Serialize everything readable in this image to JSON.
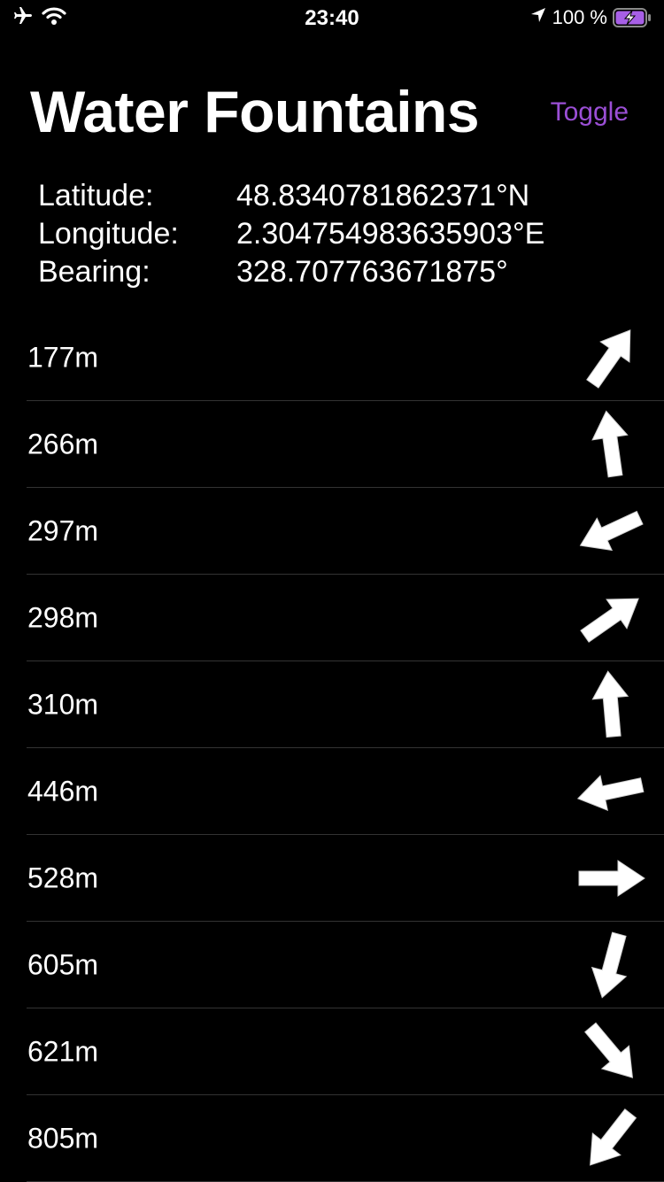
{
  "status_bar": {
    "time": "23:40",
    "battery_text": "100 %"
  },
  "header": {
    "title": "Water Fountains",
    "toggle_label": "Toggle"
  },
  "colors": {
    "accent": "#9b4fd6",
    "battery": "#a75fe6"
  },
  "info": [
    {
      "label": "Latitude:",
      "value": "48.8340781862371°N"
    },
    {
      "label": "Longitude:",
      "value": "2.304754983635903°E"
    },
    {
      "label": "Bearing:",
      "value": "328.707763671875°"
    }
  ],
  "fountains": [
    {
      "distance": "177m",
      "arrow_icon": "arrow-up-right-icon",
      "arrow_angle": 35
    },
    {
      "distance": "266m",
      "arrow_icon": "arrow-up-icon",
      "arrow_angle": -8
    },
    {
      "distance": "297m",
      "arrow_icon": "arrow-down-left-icon",
      "arrow_angle": 245
    },
    {
      "distance": "298m",
      "arrow_icon": "arrow-up-right-icon",
      "arrow_angle": 55
    },
    {
      "distance": "310m",
      "arrow_icon": "arrow-up-icon",
      "arrow_angle": -5
    },
    {
      "distance": "446m",
      "arrow_icon": "arrow-left-icon",
      "arrow_angle": 258
    },
    {
      "distance": "528m",
      "arrow_icon": "arrow-right-icon",
      "arrow_angle": 90
    },
    {
      "distance": "605m",
      "arrow_icon": "arrow-down-icon",
      "arrow_angle": 195
    },
    {
      "distance": "621m",
      "arrow_icon": "arrow-down-right-icon",
      "arrow_angle": 140
    },
    {
      "distance": "805m",
      "arrow_icon": "arrow-down-left-icon",
      "arrow_angle": 218
    }
  ]
}
